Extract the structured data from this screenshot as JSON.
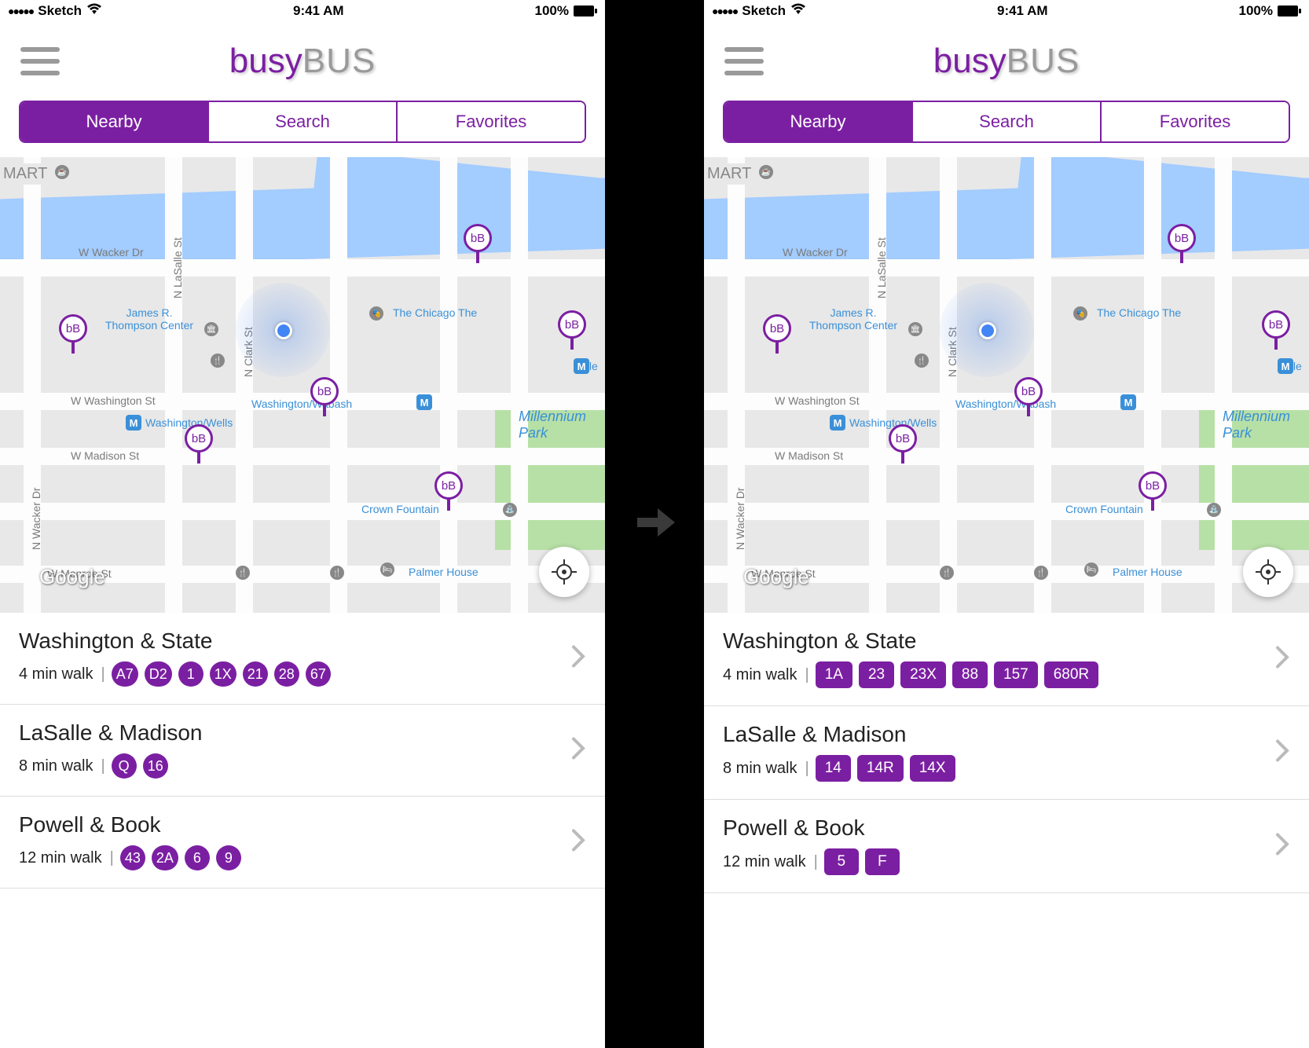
{
  "status": {
    "carrier": "Sketch",
    "time": "9:41 AM",
    "battery": "100%"
  },
  "logo": {
    "part1": "busy",
    "part2": "BUS"
  },
  "tabs": [
    "Nearby",
    "Search",
    "Favorites"
  ],
  "pin_label": "bB",
  "map": {
    "attribution": "Google",
    "cutoff": "MART",
    "streets": {
      "wacker": "W Wacker Dr",
      "washington": "W Washington St",
      "madison": "W Madison St",
      "monroe": "W Monroe St",
      "lasalle": "N LaSalle St",
      "clark": "N Clark St",
      "wackerv": "N Wacker Dr"
    },
    "poi": {
      "thompson": "James R. Thompson Center",
      "chicago": "The Chicago The",
      "ww": "Washington/Wabash",
      "wells": "Washington/Wells",
      "millpark": "Millennium Park",
      "crown": "Crown Fountain",
      "palmer": "Palmer House",
      "mille": "Mille"
    }
  },
  "left": {
    "stops": [
      {
        "name": "Washington & State",
        "walk": "4 min walk",
        "routes": [
          "A7",
          "D2",
          "1",
          "1X",
          "21",
          "28",
          "67"
        ]
      },
      {
        "name": "LaSalle & Madison",
        "walk": "8 min walk",
        "routes": [
          "Q",
          "16"
        ]
      },
      {
        "name": "Powell & Book",
        "walk": "12 min walk",
        "routes": [
          "43",
          "2A",
          "6",
          "9"
        ]
      }
    ]
  },
  "right": {
    "stops": [
      {
        "name": "Washington & State",
        "walk": "4 min walk",
        "routes": [
          "1A",
          "23",
          "23X",
          "88",
          "157",
          "680R"
        ]
      },
      {
        "name": "LaSalle & Madison",
        "walk": "8 min walk",
        "routes": [
          "14",
          "14R",
          "14X"
        ]
      },
      {
        "name": "Powell & Book",
        "walk": "12 min walk",
        "routes": [
          "5",
          "F"
        ]
      }
    ]
  }
}
